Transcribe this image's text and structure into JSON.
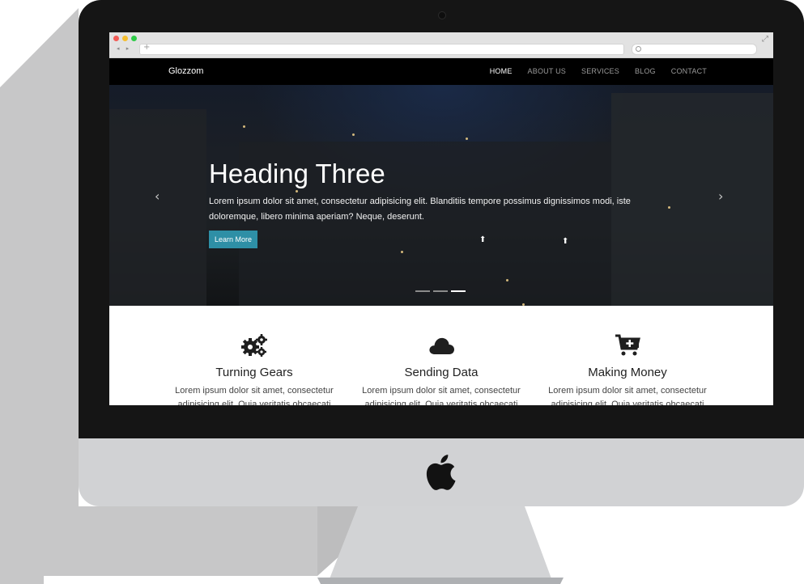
{
  "browser": {
    "url_plus": "+",
    "nav_arrows": "◂ ▸",
    "expand": "⤢"
  },
  "site": {
    "brand": "Glozzom",
    "menu": [
      "HOME",
      "ABOUT US",
      "SERVICES",
      "BLOG",
      "CONTACT"
    ],
    "active_menu_item": "HOME"
  },
  "hero": {
    "title": "Heading Three",
    "text": "Lorem ipsum dolor sit amet, consectetur adipisicing elit. Blanditiis tempore possimus dignissimos modi, iste doloremque, libero minima aperiam? Neque, deserunt.",
    "button": "Learn More",
    "prev_arrow": "‹",
    "next_arrow": "›",
    "slides": 3,
    "active_slide": 3
  },
  "features": [
    {
      "icon": "gears-icon",
      "title": "Turning Gears",
      "text": "Lorem ipsum dolor sit amet, consectetur adipisicing elit. Quia veritatis obcaecati"
    },
    {
      "icon": "cloud-icon",
      "title": "Sending Data",
      "text": "Lorem ipsum dolor sit amet, consectetur adipisicing elit. Quia veritatis obcaecati"
    },
    {
      "icon": "cart-plus-icon",
      "title": "Making Money",
      "text": "Lorem ipsum dolor sit amet, consectetur adipisicing elit. Quia veritatis obcaecati"
    }
  ],
  "colors": {
    "accent": "#2e8fa6",
    "nav_bg": "#000000",
    "bezel": "#151515",
    "chin": "#d1d2d4"
  }
}
